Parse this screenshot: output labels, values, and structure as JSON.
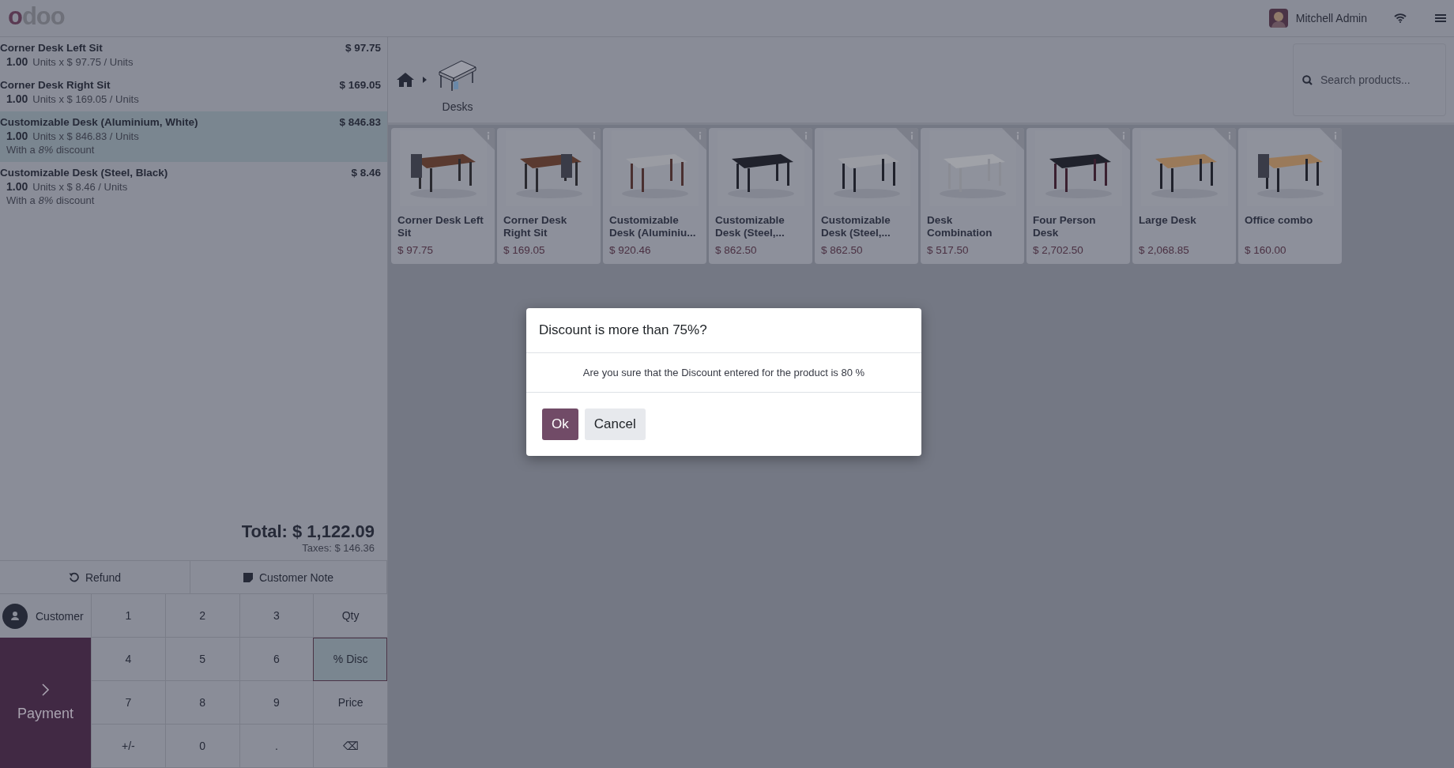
{
  "header": {
    "logo": "odoo",
    "user": "Mitchell Admin"
  },
  "order_lines": [
    {
      "name": "Corner Desk Left Sit",
      "price": "$ 97.75",
      "quantity": "1.00",
      "unit_detail": "Units x $ 97.75 / Units",
      "selected": false
    },
    {
      "name": "Corner Desk Right Sit",
      "price": "$ 169.05",
      "quantity": "1.00",
      "unit_detail": "Units x $ 169.05 / Units",
      "selected": false
    },
    {
      "name": "Customizable Desk (Aluminium, White)",
      "price": "$ 846.83",
      "quantity": "1.00",
      "unit_detail": "Units x $ 846.83 / Units",
      "discount": "With a *8%* discount",
      "selected": true
    },
    {
      "name": "Customizable Desk (Steel, Black)",
      "price": "$ 8.46",
      "quantity": "1.00",
      "unit_detail": "Units x $ 8.46 / Units",
      "discount": "With a *8%* discount",
      "selected": false
    }
  ],
  "total": "Total: $ 1,122.09",
  "taxes": "Taxes: $ 146.36",
  "actions": [
    {
      "label": "Refund",
      "kind": "refund"
    },
    {
      "label": "Customer Note",
      "kind": "note"
    }
  ],
  "customer_button": "Customer",
  "payment_button": "Payment",
  "numpad": [
    {
      "label": "1",
      "selected": false
    },
    {
      "label": "2",
      "selected": false
    },
    {
      "label": "3",
      "selected": false
    },
    {
      "label": "Qty",
      "selected": false
    },
    {
      "label": "4",
      "selected": false
    },
    {
      "label": "5",
      "selected": false
    },
    {
      "label": "6",
      "selected": false
    },
    {
      "label": "% Disc",
      "selected": true
    },
    {
      "label": "7",
      "selected": false
    },
    {
      "label": "8",
      "selected": false
    },
    {
      "label": "9",
      "selected": false
    },
    {
      "label": "Price",
      "selected": false
    },
    {
      "label": "+/-",
      "selected": false
    },
    {
      "label": "0",
      "selected": false
    },
    {
      "label": ".",
      "selected": false
    },
    {
      "label": "⌫",
      "selected": false
    }
  ],
  "breadcrumb": {
    "category": "Desks"
  },
  "search": {
    "placeholder": "Search products..."
  },
  "products": [
    {
      "name": "Corner Desk Left Sit",
      "price": "$ 97.75"
    },
    {
      "name": "Corner Desk Right Sit",
      "price": "$ 169.05"
    },
    {
      "name": "Customizable Desk (Aluminiu...",
      "price": "$ 920.46"
    },
    {
      "name": "Customizable Desk (Steel,...",
      "price": "$ 862.50"
    },
    {
      "name": "Customizable Desk (Steel,...",
      "price": "$ 862.50"
    },
    {
      "name": "Desk Combination",
      "price": "$ 517.50"
    },
    {
      "name": "Four Person Desk",
      "price": "$ 2,702.50"
    },
    {
      "name": "Large Desk",
      "price": "$ 2,068.85"
    },
    {
      "name": "Office combo",
      "price": "$ 160.00"
    }
  ],
  "dialog": {
    "title": "Discount is more than 75%?",
    "body": "Are you sure that the Discount entered for the product is 80 %",
    "buttons": [
      {
        "label": "Ok",
        "kind": "primary"
      },
      {
        "label": "Cancel",
        "kind": "secondary"
      }
    ]
  }
}
